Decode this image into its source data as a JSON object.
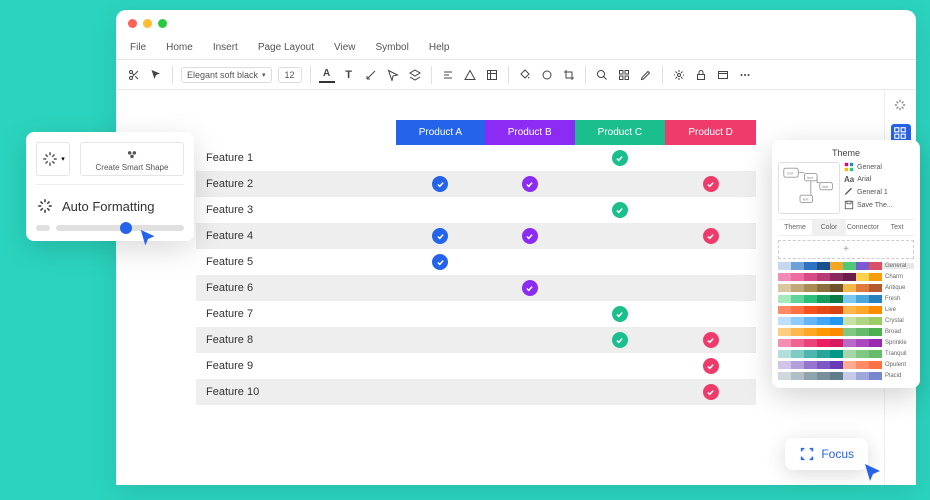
{
  "menubar": [
    "File",
    "Home",
    "Insert",
    "Page Layout",
    "View",
    "Symbol",
    "Help"
  ],
  "toolbar": {
    "font": "Elegant soft black",
    "size": "12"
  },
  "table": {
    "products": [
      {
        "key": "A",
        "label": "Product A",
        "color": "#2563eb"
      },
      {
        "key": "B",
        "label": "Product B",
        "color": "#8b2bf4"
      },
      {
        "key": "C",
        "label": "Product C",
        "color": "#1bbf8e"
      },
      {
        "key": "D",
        "label": "Product D",
        "color": "#ef3b6b"
      }
    ],
    "features": [
      {
        "label": "Feature 1",
        "checks": {
          "A": false,
          "B": false,
          "C": true,
          "D": false
        }
      },
      {
        "label": "Feature 2",
        "checks": {
          "A": true,
          "B": true,
          "C": false,
          "D": true
        }
      },
      {
        "label": "Feature 3",
        "checks": {
          "A": false,
          "B": false,
          "C": true,
          "D": false
        }
      },
      {
        "label": "Feature 4",
        "checks": {
          "A": true,
          "B": true,
          "C": false,
          "D": true
        }
      },
      {
        "label": "Feature 5",
        "checks": {
          "A": true,
          "B": false,
          "C": false,
          "D": false
        }
      },
      {
        "label": "Feature 6",
        "checks": {
          "A": false,
          "B": true,
          "C": false,
          "D": false
        }
      },
      {
        "label": "Feature 7",
        "checks": {
          "A": false,
          "B": false,
          "C": true,
          "D": false
        }
      },
      {
        "label": "Feature 8",
        "checks": {
          "A": false,
          "B": false,
          "C": true,
          "D": true
        }
      },
      {
        "label": "Feature 9",
        "checks": {
          "A": false,
          "B": false,
          "C": false,
          "D": true
        }
      },
      {
        "label": "Feature 10",
        "checks": {
          "A": false,
          "B": false,
          "C": false,
          "D": true
        }
      }
    ]
  },
  "smart_popup": {
    "create_label": "Create Smart Shape",
    "auto_label": "Auto Formatting"
  },
  "theme_panel": {
    "title": "Theme",
    "side": [
      {
        "icon": "grid",
        "label": "General"
      },
      {
        "icon": "Aa",
        "label": "Arial"
      },
      {
        "icon": "line",
        "label": "General 1"
      },
      {
        "icon": "disk",
        "label": "Save The..."
      }
    ],
    "tabs": [
      "Theme",
      "Color",
      "Connector",
      "Text"
    ],
    "active_tab": 1,
    "swatches": [
      {
        "name": "General",
        "colors": [
          "#c5d8ef",
          "#6fa1d9",
          "#2f72c3",
          "#1b4e8c",
          "#f5a623",
          "#50c878",
          "#7b5bd1",
          "#d94f66"
        ]
      },
      {
        "name": "Charm",
        "colors": [
          "#f08bb8",
          "#ef6aa0",
          "#d84a85",
          "#b83a74",
          "#8a2960",
          "#6a1d4b",
          "#fbd24e",
          "#f59e0b"
        ]
      },
      {
        "name": "Antique",
        "colors": [
          "#d9c7a0",
          "#c2a876",
          "#a88b55",
          "#8c6e3e",
          "#6e532a",
          "#f3b84a",
          "#e0793c",
          "#b55a30"
        ]
      },
      {
        "name": "Fresh",
        "colors": [
          "#a7e8bd",
          "#5fd39a",
          "#2fbf7c",
          "#1a9c60",
          "#0e7a48",
          "#7bc8f0",
          "#4aa7dd",
          "#2a7fbf"
        ]
      },
      {
        "name": "Live",
        "colors": [
          "#ff8a65",
          "#ff7043",
          "#f4511e",
          "#e64a19",
          "#d84315",
          "#ffb74d",
          "#ffa726",
          "#fb8c00"
        ]
      },
      {
        "name": "Crystal",
        "colors": [
          "#bde0fe",
          "#90caf9",
          "#64b5f6",
          "#42a5f5",
          "#2196f3",
          "#c5e1a5",
          "#aed581",
          "#9ccc65"
        ]
      },
      {
        "name": "Broad",
        "colors": [
          "#ffcc80",
          "#ffb74d",
          "#ffa726",
          "#ff9800",
          "#fb8c00",
          "#81c784",
          "#66bb6a",
          "#4caf50"
        ]
      },
      {
        "name": "Sprinkle",
        "colors": [
          "#f48fb1",
          "#f06292",
          "#ec407a",
          "#e91e63",
          "#d81b60",
          "#ba68c8",
          "#ab47bc",
          "#9c27b0"
        ]
      },
      {
        "name": "Tranquil",
        "colors": [
          "#b2dfdb",
          "#80cbc4",
          "#4db6ac",
          "#26a69a",
          "#009688",
          "#a5d6a7",
          "#81c784",
          "#66bb6a"
        ]
      },
      {
        "name": "Opulent",
        "colors": [
          "#d1c4e9",
          "#b39ddb",
          "#9575cd",
          "#7e57c2",
          "#673ab7",
          "#ffab91",
          "#ff8a65",
          "#ff7043"
        ]
      },
      {
        "name": "Placid",
        "colors": [
          "#cfd8dc",
          "#b0bec5",
          "#90a4ae",
          "#78909c",
          "#607d8b",
          "#c5cae9",
          "#9fa8da",
          "#7986cb"
        ]
      }
    ]
  },
  "focus": {
    "label": "Focus"
  }
}
